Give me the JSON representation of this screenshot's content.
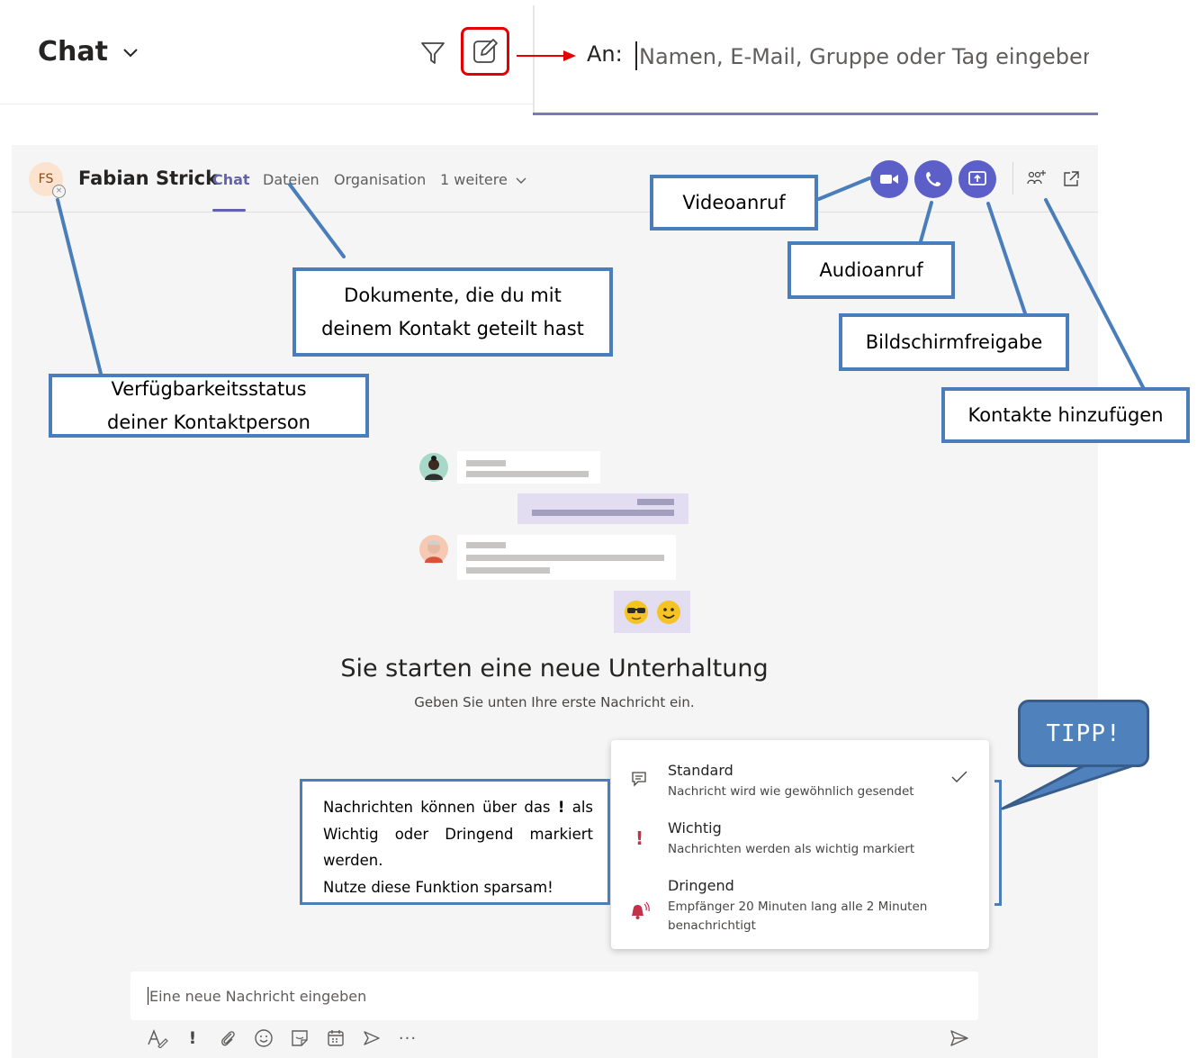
{
  "header": {
    "title": "Chat",
    "to_label": "An:",
    "to_placeholder": "Namen, E-Mail, Gruppe oder Tag eingeben"
  },
  "chat": {
    "avatar_initials": "FS",
    "contact_name": "Fabian Strick",
    "tabs": [
      "Chat",
      "Dateien",
      "Organisation",
      "1 weitere"
    ],
    "active_tab": "Chat",
    "empty_title": "Sie starten eine neue Unterhaltung",
    "empty_subtitle": "Geben Sie unten Ihre erste Nachricht ein.",
    "compose_placeholder": "Eine neue Nachricht eingeben"
  },
  "priority_menu": {
    "items": [
      {
        "title": "Standard",
        "desc": "Nachricht wird wie gewöhnlich gesendet",
        "selected": true,
        "icon": "message-icon"
      },
      {
        "title": "Wichtig",
        "desc": "Nachrichten werden als wichtig markiert",
        "selected": false,
        "icon": "exclamation-icon"
      },
      {
        "title": "Dringend",
        "desc_line1": "Empfänger 20 Minuten lang alle 2 Minuten",
        "desc_line2": "benachrichtigt",
        "selected": false,
        "icon": "bell-ringing-icon"
      }
    ]
  },
  "callouts": {
    "status": [
      "Verfügbarkeitsstatus",
      "deiner Kontaktperson"
    ],
    "files": [
      "Dokumente, die du mit",
      "deinem Kontakt geteilt hast"
    ],
    "video": "Videoanruf",
    "audio": "Audioanruf",
    "screen": "Bildschirmfreigabe",
    "contacts": "Kontakte hinzufügen",
    "tip": "TIPP!",
    "info_lines": [
      "Nachrichten können über das",
      "!",
      "als",
      "Wichtig oder Dringend markiert",
      "werden.",
      "Nutze diese Funktion sparsam!"
    ]
  },
  "colors": {
    "accent": "#6264a7",
    "call_button": "#5b5fc7",
    "callout_border": "#4a7ebb",
    "tip_fill": "#4f81bd",
    "highlight_red": "#e40000",
    "important_red": "#c4314b"
  }
}
